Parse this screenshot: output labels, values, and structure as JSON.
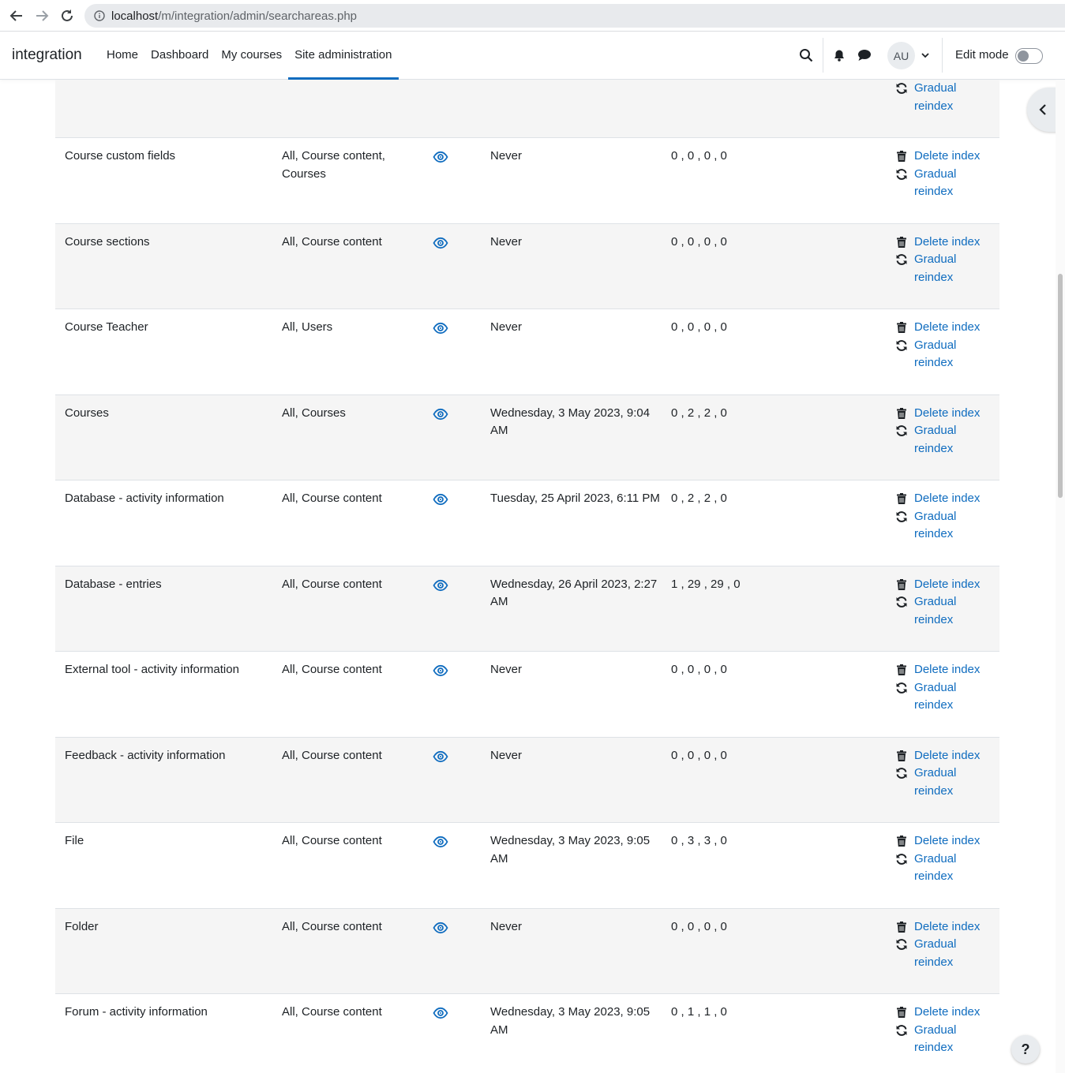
{
  "browser": {
    "url_host": "localhost",
    "url_path": "/m/integration/admin/searchareas.php"
  },
  "navbar": {
    "brand": "integration",
    "items": [
      {
        "label": "Home"
      },
      {
        "label": "Dashboard"
      },
      {
        "label": "My courses"
      },
      {
        "label": "Site administration",
        "active": true
      }
    ],
    "avatar_initials": "AU",
    "edit_mode_label": "Edit mode",
    "edit_mode_on": false
  },
  "accent_color": "#0f6cbf",
  "top_partial_row": {
    "actions": [
      "Gradual reindex"
    ]
  },
  "rows": [
    {
      "name": "Course custom fields",
      "context": "All, Course content, Courses",
      "last_indexed": "Never",
      "counts": "0 , 0 , 0 , 0"
    },
    {
      "name": "Course sections",
      "context": "All, Course content",
      "last_indexed": "Never",
      "counts": "0 , 0 , 0 , 0"
    },
    {
      "name": "Course Teacher",
      "context": "All, Users",
      "last_indexed": "Never",
      "counts": "0 , 0 , 0 , 0"
    },
    {
      "name": "Courses",
      "context": "All, Courses",
      "last_indexed": "Wednesday, 3 May 2023, 9:04 AM",
      "counts": "0 , 2 , 2 , 0"
    },
    {
      "name": "Database - activity information",
      "context": "All, Course content",
      "last_indexed": "Tuesday, 25 April 2023, 6:11 PM",
      "counts": "0 , 2 , 2 , 0"
    },
    {
      "name": "Database - entries",
      "context": "All, Course content",
      "last_indexed": "Wednesday, 26 April 2023, 2:27 AM",
      "counts": "1 , 29 , 29 , 0"
    },
    {
      "name": "External tool - activity information",
      "context": "All, Course content",
      "last_indexed": "Never",
      "counts": "0 , 0 , 0 , 0"
    },
    {
      "name": "Feedback - activity information",
      "context": "All, Course content",
      "last_indexed": "Never",
      "counts": "0 , 0 , 0 , 0"
    },
    {
      "name": "File",
      "context": "All, Course content",
      "last_indexed": "Wednesday, 3 May 2023, 9:05 AM",
      "counts": "0 , 3 , 3 , 0"
    },
    {
      "name": "Folder",
      "context": "All, Course content",
      "last_indexed": "Never",
      "counts": "0 , 0 , 0 , 0"
    },
    {
      "name": "Forum - activity information",
      "context": "All, Course content",
      "last_indexed": "Wednesday, 3 May 2023, 9:05 AM",
      "counts": "0 , 1 , 1 , 0"
    }
  ],
  "actions": {
    "delete_label": "Delete index",
    "reindex_label": "Gradual reindex"
  },
  "help_label": "?"
}
